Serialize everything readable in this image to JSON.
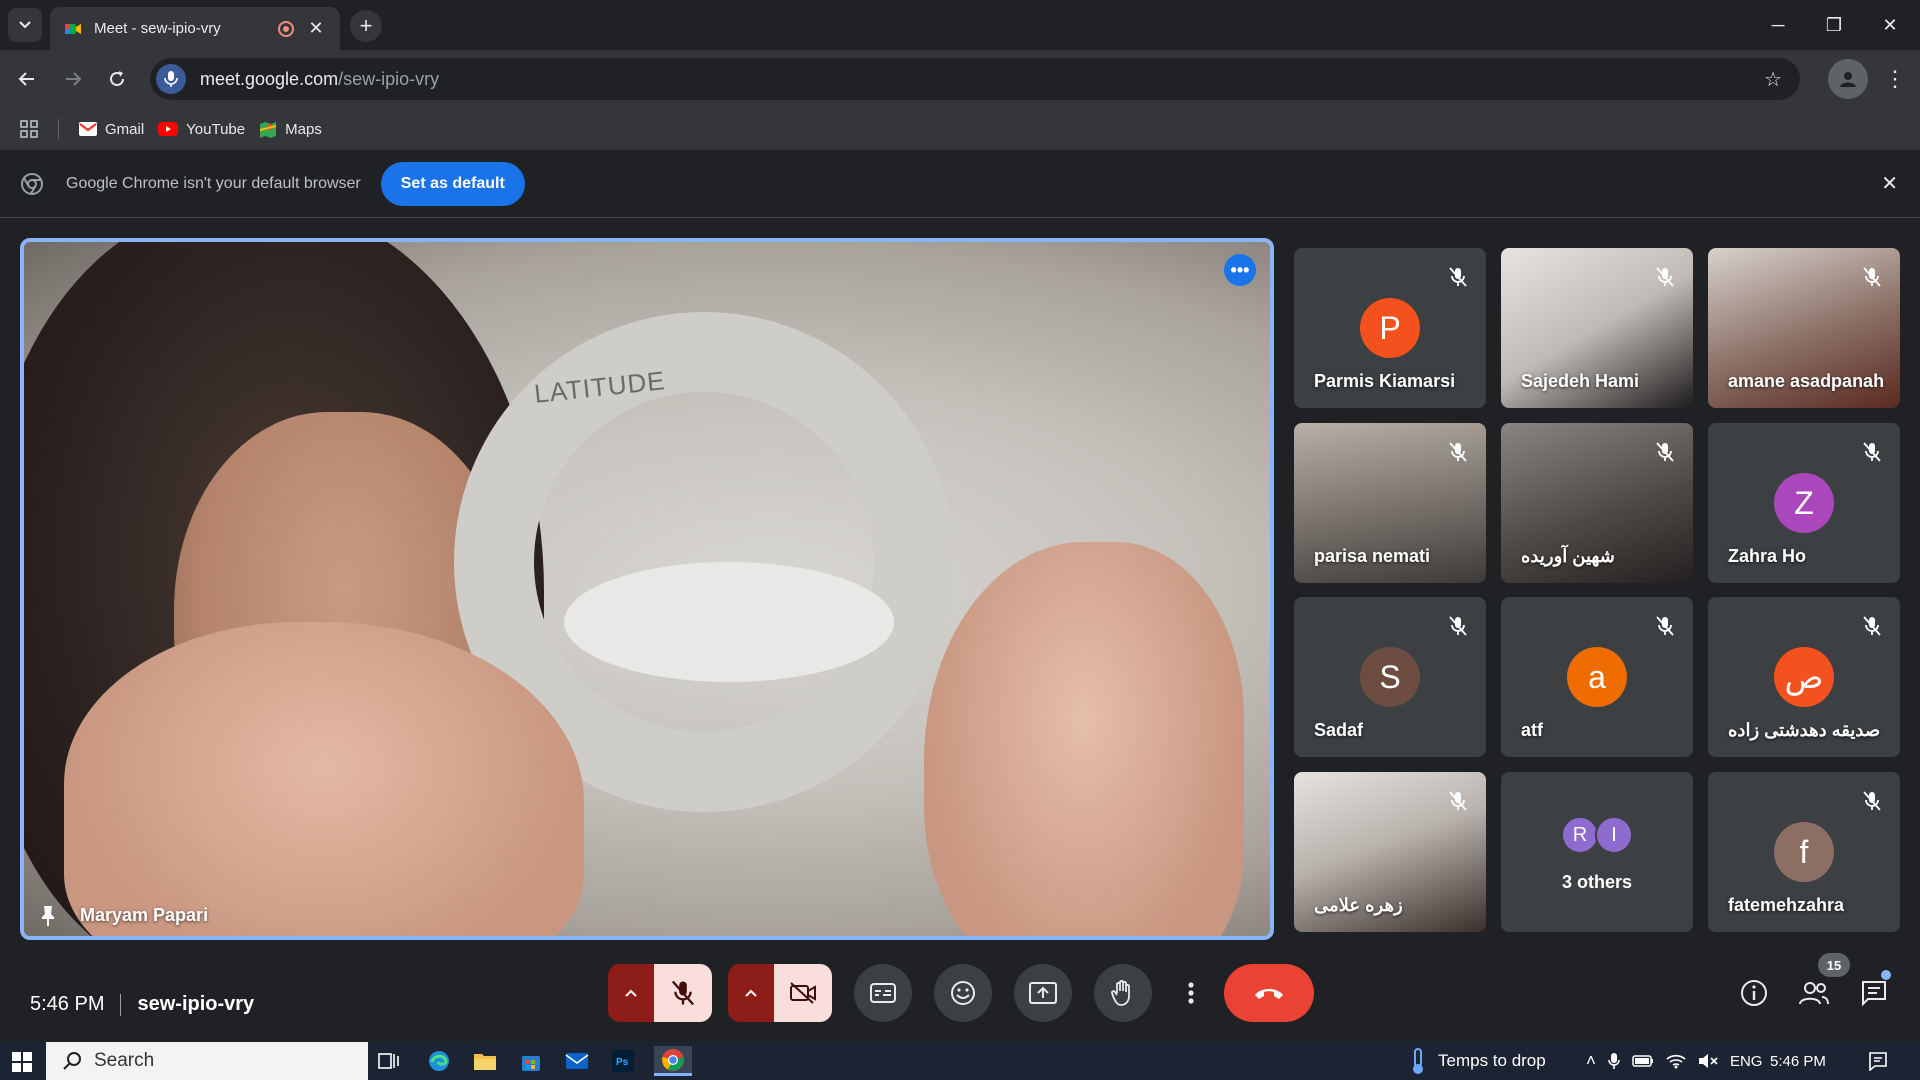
{
  "browser": {
    "tab_title": "Meet - sew-ipio-vry",
    "url_host": "meet.google.com",
    "url_path": "/sew-ipio-vry",
    "bookmarks": [
      {
        "label": "Gmail",
        "icon": "gmail-icon"
      },
      {
        "label": "YouTube",
        "icon": "youtube-icon"
      },
      {
        "label": "Maps",
        "icon": "maps-icon"
      }
    ],
    "infobar_message": "Google Chrome isn't your default browser",
    "infobar_button": "Set as default"
  },
  "meet": {
    "main_speaker": "Maryam Papari",
    "main_video_text": "LATITUDE",
    "participants": [
      {
        "name": "Parmis Kiamarsi",
        "initial": "P",
        "color": "#f4511e",
        "video": false
      },
      {
        "name": "Sajedeh Hami",
        "video": true
      },
      {
        "name": "amane asadpanah",
        "video": true
      },
      {
        "name": "parisa nemati",
        "video": true
      },
      {
        "name": "شهین آوریده",
        "video": true
      },
      {
        "name": "Zahra Ho",
        "initial": "Z",
        "color": "#ab47bc",
        "video": false
      },
      {
        "name": "Sadaf",
        "initial": "S",
        "color": "#6d4c41",
        "video": false
      },
      {
        "name": "atf",
        "initial": "a",
        "color": "#ef6c00",
        "video": false
      },
      {
        "name": "صدیقه دهدشتی زاده",
        "initial": "ص",
        "color": "#f4511e",
        "video": false
      },
      {
        "name": "زهره علامی",
        "video": true
      },
      {
        "name": "fatemehzahra",
        "initial": "f",
        "color": "#8d6e63",
        "video": false
      }
    ],
    "others": {
      "label": "3 others",
      "initials": [
        "R",
        "I"
      ]
    },
    "time": "5:46 PM",
    "meeting_code": "sew-ipio-vry",
    "people_count": "15"
  },
  "taskbar": {
    "search_label": "Search",
    "weather_text": "Temps to drop",
    "language": "ENG",
    "time": "5:46 PM"
  }
}
